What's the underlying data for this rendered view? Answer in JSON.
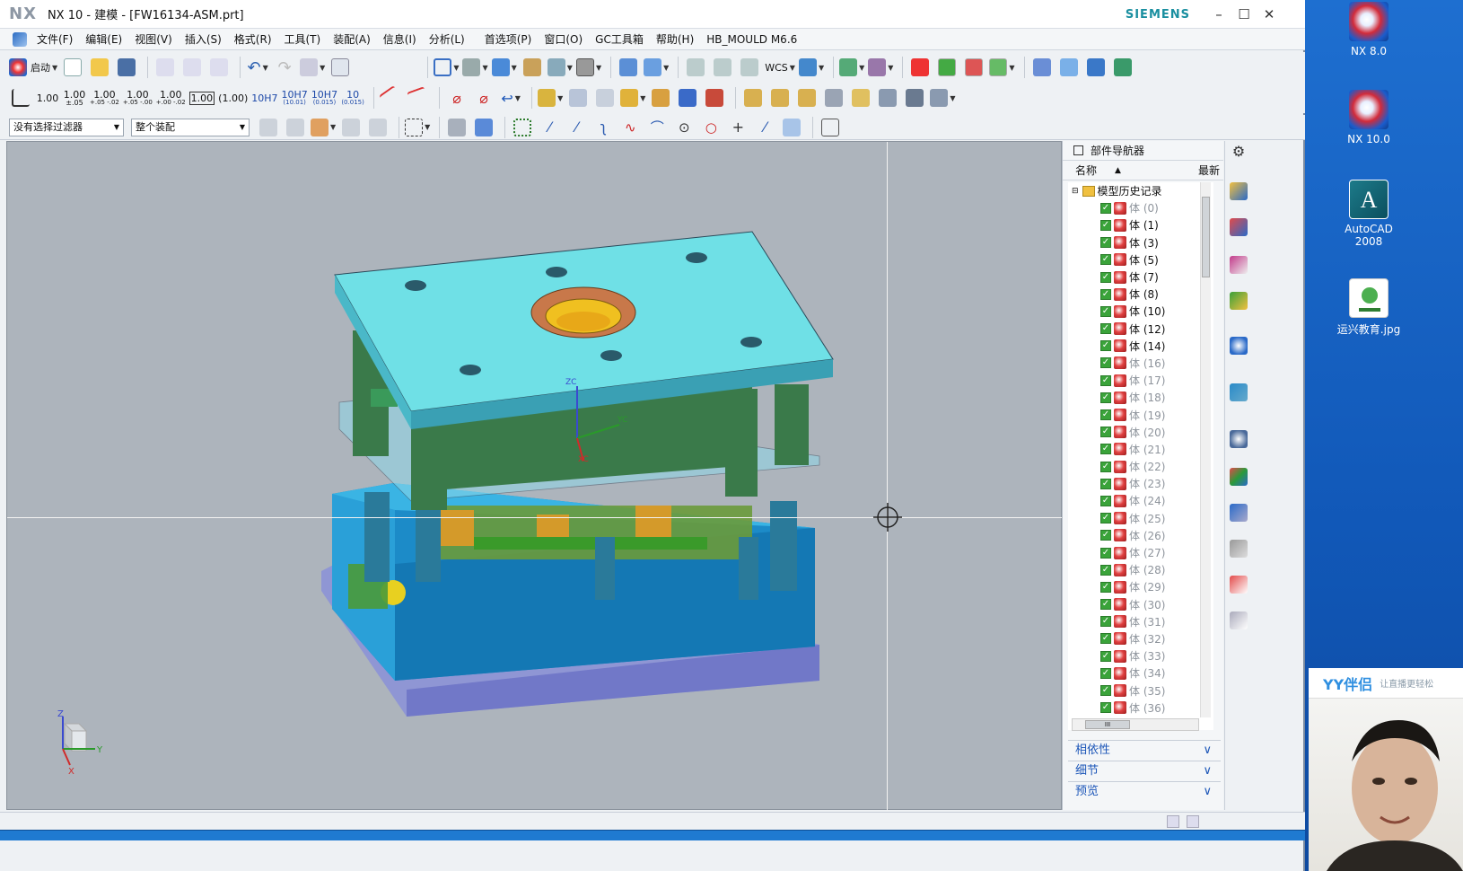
{
  "window": {
    "logo": "NX",
    "title": "NX 10 - 建模 - [FW16134-ASM.prt]",
    "brand": "SIEMENS"
  },
  "menu": {
    "items": [
      "文件(F)",
      "编辑(E)",
      "视图(V)",
      "插入(S)",
      "格式(R)",
      "工具(T)",
      "装配(A)",
      "信息(I)",
      "分析(L)",
      "首选项(P)",
      "窗口(O)",
      "GC工具箱",
      "帮助(H)",
      "HB_MOULD M6.6"
    ]
  },
  "toolbar": {
    "start_label": "启动",
    "wcs_label": "WCS",
    "dims": {
      "d1": "1.00",
      "d2_top": "1.00",
      "d2_bot": "±.05",
      "d3_top": "1.00",
      "d3_bot": "+.05 -.02",
      "d4_top": "1.00",
      "d4_bot": "+.05 -.00",
      "d5_top": "1.00",
      "d5_bot": "+.00 -.02",
      "d6": "1.00",
      "d7": "(1.00)",
      "d8": "10H7",
      "d9_top": "10H7",
      "d9_bot": "(10.01)",
      "d10_top": "10H7",
      "d10_bot": "(0.015)",
      "d11_top": "10",
      "d11_bot": "(0.015)"
    },
    "filter_select": "没有选择过滤器",
    "scope_select": "整个装配"
  },
  "viewport": {
    "axes": {
      "x": "X",
      "y": "Y",
      "z": "Z",
      "xc": "XC",
      "yc": "YC",
      "zc": "ZC"
    }
  },
  "navigator": {
    "title": "部件导航器",
    "col_name": "名称",
    "col_latest": "最新",
    "root_label": "模型历史记录",
    "rows": [
      {
        "label": "体 (0)",
        "dim": true
      },
      {
        "label": "体 (1)",
        "dim": false
      },
      {
        "label": "体 (3)",
        "dim": false
      },
      {
        "label": "体 (5)",
        "dim": false
      },
      {
        "label": "体 (7)",
        "dim": false
      },
      {
        "label": "体 (8)",
        "dim": false
      },
      {
        "label": "体 (10)",
        "dim": false
      },
      {
        "label": "体 (12)",
        "dim": false
      },
      {
        "label": "体 (14)",
        "dim": false
      },
      {
        "label": "体 (16)",
        "dim": true
      },
      {
        "label": "体 (17)",
        "dim": true
      },
      {
        "label": "体 (18)",
        "dim": true
      },
      {
        "label": "体 (19)",
        "dim": true
      },
      {
        "label": "体 (20)",
        "dim": true
      },
      {
        "label": "体 (21)",
        "dim": true
      },
      {
        "label": "体 (22)",
        "dim": true
      },
      {
        "label": "体 (23)",
        "dim": true
      },
      {
        "label": "体 (24)",
        "dim": true
      },
      {
        "label": "体 (25)",
        "dim": true
      },
      {
        "label": "体 (26)",
        "dim": true
      },
      {
        "label": "体 (27)",
        "dim": true
      },
      {
        "label": "体 (28)",
        "dim": true
      },
      {
        "label": "体 (29)",
        "dim": true
      },
      {
        "label": "体 (30)",
        "dim": true
      },
      {
        "label": "体 (31)",
        "dim": true
      },
      {
        "label": "体 (32)",
        "dim": true
      },
      {
        "label": "体 (33)",
        "dim": true
      },
      {
        "label": "体 (34)",
        "dim": true
      },
      {
        "label": "体 (35)",
        "dim": true
      },
      {
        "label": "体 (36)",
        "dim": true
      }
    ],
    "panels": [
      "相依性",
      "细节",
      "预览"
    ],
    "hscroll_grip": "III"
  },
  "desktop": {
    "icons": [
      "NX 8.0",
      "NX 10.0",
      "AutoCAD 2008",
      "运兴教育.jpg"
    ]
  },
  "webcam": {
    "logo": "YY伴侣",
    "slogan": "让直播更轻松"
  }
}
